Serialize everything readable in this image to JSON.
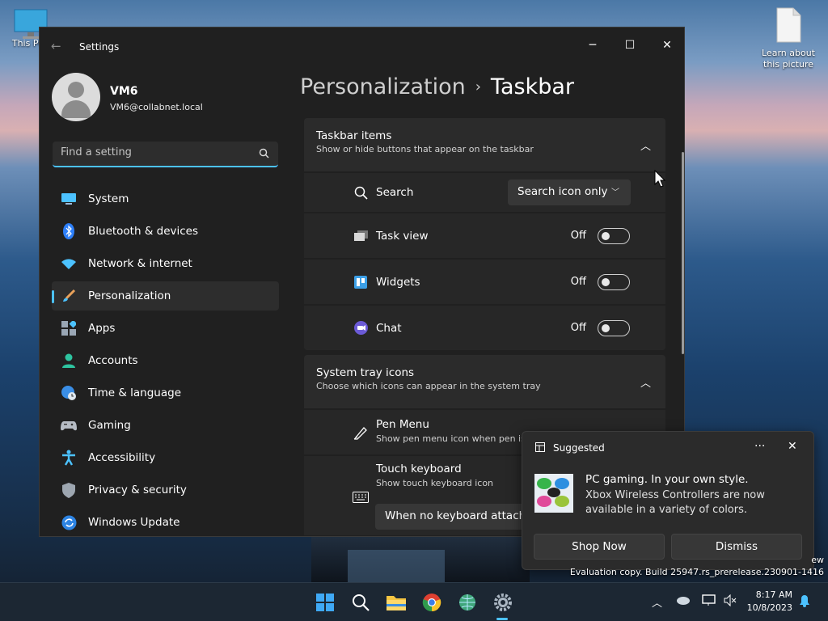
{
  "desktop": {
    "icons": [
      {
        "label": "This PC"
      },
      {
        "label": "Learn about this picture"
      }
    ],
    "watermark_line1": "ew",
    "watermark_line2": "Evaluation copy. Build 25947.rs_prerelease.230901-1416"
  },
  "window": {
    "title": "Settings",
    "back_icon": "back-arrow-icon",
    "minimize": "─",
    "maximize": "☐",
    "close": "✕"
  },
  "user": {
    "name": "VM6",
    "email": "VM6@collabnet.local"
  },
  "search": {
    "placeholder": "Find a setting"
  },
  "sidebar": {
    "items": [
      {
        "label": "System",
        "icon": "system-icon"
      },
      {
        "label": "Bluetooth & devices",
        "icon": "bluetooth-icon"
      },
      {
        "label": "Network & internet",
        "icon": "wifi-icon"
      },
      {
        "label": "Personalization",
        "icon": "brush-icon",
        "selected": true
      },
      {
        "label": "Apps",
        "icon": "apps-icon"
      },
      {
        "label": "Accounts",
        "icon": "person-icon"
      },
      {
        "label": "Time & language",
        "icon": "globe-clock-icon"
      },
      {
        "label": "Gaming",
        "icon": "gamepad-icon"
      },
      {
        "label": "Accessibility",
        "icon": "accessibility-icon"
      },
      {
        "label": "Privacy & security",
        "icon": "shield-icon"
      },
      {
        "label": "Windows Update",
        "icon": "update-icon"
      }
    ]
  },
  "breadcrumb": {
    "parent": "Personalization",
    "separator": "›",
    "current": "Taskbar"
  },
  "taskbar_items": {
    "title": "Taskbar items",
    "subtitle": "Show or hide buttons that appear on the taskbar",
    "search": {
      "label": "Search",
      "value": "Search icon only"
    },
    "task_view": {
      "label": "Task view",
      "state": "Off"
    },
    "widgets": {
      "label": "Widgets",
      "state": "Off"
    },
    "chat": {
      "label": "Chat",
      "state": "Off"
    }
  },
  "system_tray": {
    "title": "System tray icons",
    "subtitle": "Choose which icons can appear in the system tray",
    "pen_menu": {
      "label": "Pen Menu",
      "sub": "Show pen menu icon when pen is"
    },
    "touch_keyboard": {
      "label": "Touch keyboard",
      "sub": "Show touch keyboard icon",
      "value": "When no keyboard attached"
    }
  },
  "toast": {
    "app": "Suggested",
    "more": "···",
    "close": "✕",
    "title": "PC gaming. In your own style.",
    "body": "Xbox Wireless Controllers are now available in a variety of colors.",
    "primary": "Shop Now",
    "secondary": "Dismiss"
  },
  "taskbar": {
    "time": "8:17 AM",
    "date": "10/8/2023",
    "accent": "#4cc2ff"
  }
}
